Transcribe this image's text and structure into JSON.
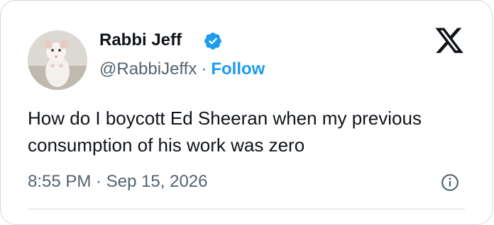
{
  "author": {
    "display_name": "Rabbi Jeff",
    "handle": "@RabbiJeffx",
    "separator": "·",
    "follow_label": "Follow",
    "verified": true
  },
  "tweet": {
    "text": "How do I boycott Ed Sheeran when my previous consumption of his work was zero",
    "timestamp": "8:55 PM · Sep 15, 2026"
  },
  "icons": {
    "brand": "x-logo-icon",
    "verified": "verified-badge-icon",
    "info": "info-icon"
  },
  "colors": {
    "accent": "#1d9bf0",
    "text": "#0f1419",
    "secondary_text": "#536471",
    "border": "#cfd9de"
  }
}
